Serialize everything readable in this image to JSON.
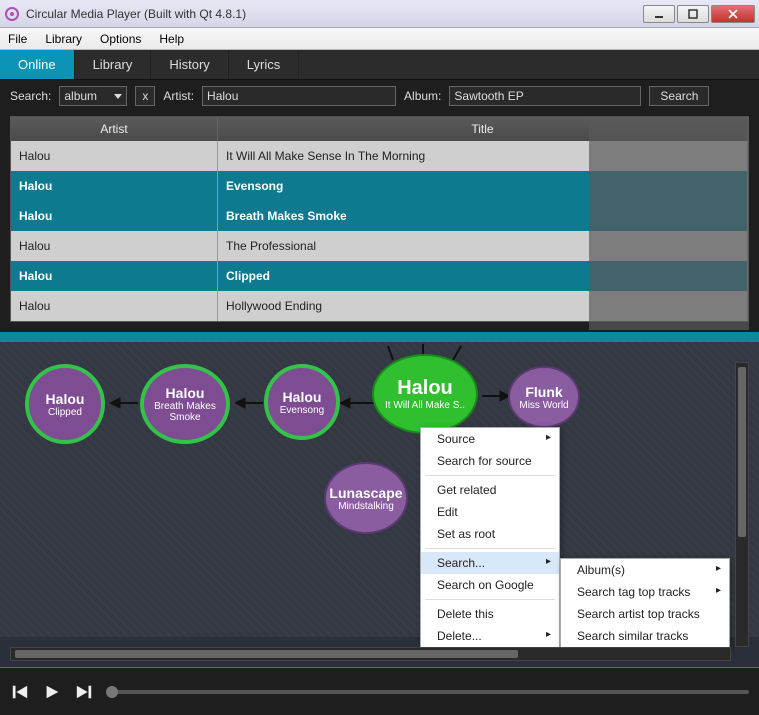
{
  "window": {
    "title": "Circular Media Player (Built with Qt 4.8.1)"
  },
  "menubar": {
    "items": [
      "File",
      "Library",
      "Options",
      "Help"
    ]
  },
  "tabs": {
    "items": [
      "Online",
      "Library",
      "History",
      "Lyrics"
    ],
    "active": "Online"
  },
  "search": {
    "label": "Search:",
    "mode": "album",
    "clear": "x",
    "artist_label": "Artist:",
    "artist_value": "Halou",
    "album_label": "Album:",
    "album_value": "Sawtooth EP",
    "button": "Search"
  },
  "table": {
    "headers": {
      "artist": "Artist",
      "title": "Title"
    },
    "rows": [
      {
        "artist": "Halou",
        "title": "It Will All Make Sense In The Morning",
        "hl": false
      },
      {
        "artist": "Halou",
        "title": "Evensong",
        "hl": true
      },
      {
        "artist": "Halou",
        "title": "Breath Makes Smoke",
        "hl": true
      },
      {
        "artist": "Halou",
        "title": "The Professional",
        "hl": false
      },
      {
        "artist": "Halou",
        "title": "Clipped",
        "hl": true
      },
      {
        "artist": "Halou",
        "title": "Hollywood Ending",
        "hl": false
      }
    ]
  },
  "viz": {
    "main": {
      "artist": "Halou",
      "track": "It Will All Make S.."
    },
    "left1": {
      "artist": "Halou",
      "track": "Clipped"
    },
    "left2": {
      "artist": "Halou",
      "track": "Breath Makes Smoke"
    },
    "left3": {
      "artist": "Halou",
      "track": "Evensong"
    },
    "right1": {
      "artist": "Flunk",
      "track": "Miss World"
    },
    "below": {
      "artist": "Lunascape",
      "track": "Mindstalking"
    }
  },
  "context": {
    "items": [
      {
        "label": "Source",
        "sub": true
      },
      {
        "label": "Search for source"
      },
      {
        "sep": true
      },
      {
        "label": "Get related"
      },
      {
        "label": "Edit"
      },
      {
        "label": "Set as root"
      },
      {
        "sep": true
      },
      {
        "label": "Search...",
        "sub": true,
        "hl": true
      },
      {
        "label": "Search on Google"
      },
      {
        "sep": true
      },
      {
        "label": "Delete this"
      },
      {
        "label": "Delete...",
        "sub": true
      }
    ],
    "submenu": [
      {
        "label": "Album(s)",
        "sub": true
      },
      {
        "label": "Search tag top tracks",
        "sub": true
      },
      {
        "label": "Search artist top tracks"
      },
      {
        "label": "Search similar tracks"
      }
    ]
  },
  "accent_primary": "#0b94b5",
  "accent_node_green": "#2fbf2f",
  "accent_node_purple": "#8a5ca0"
}
